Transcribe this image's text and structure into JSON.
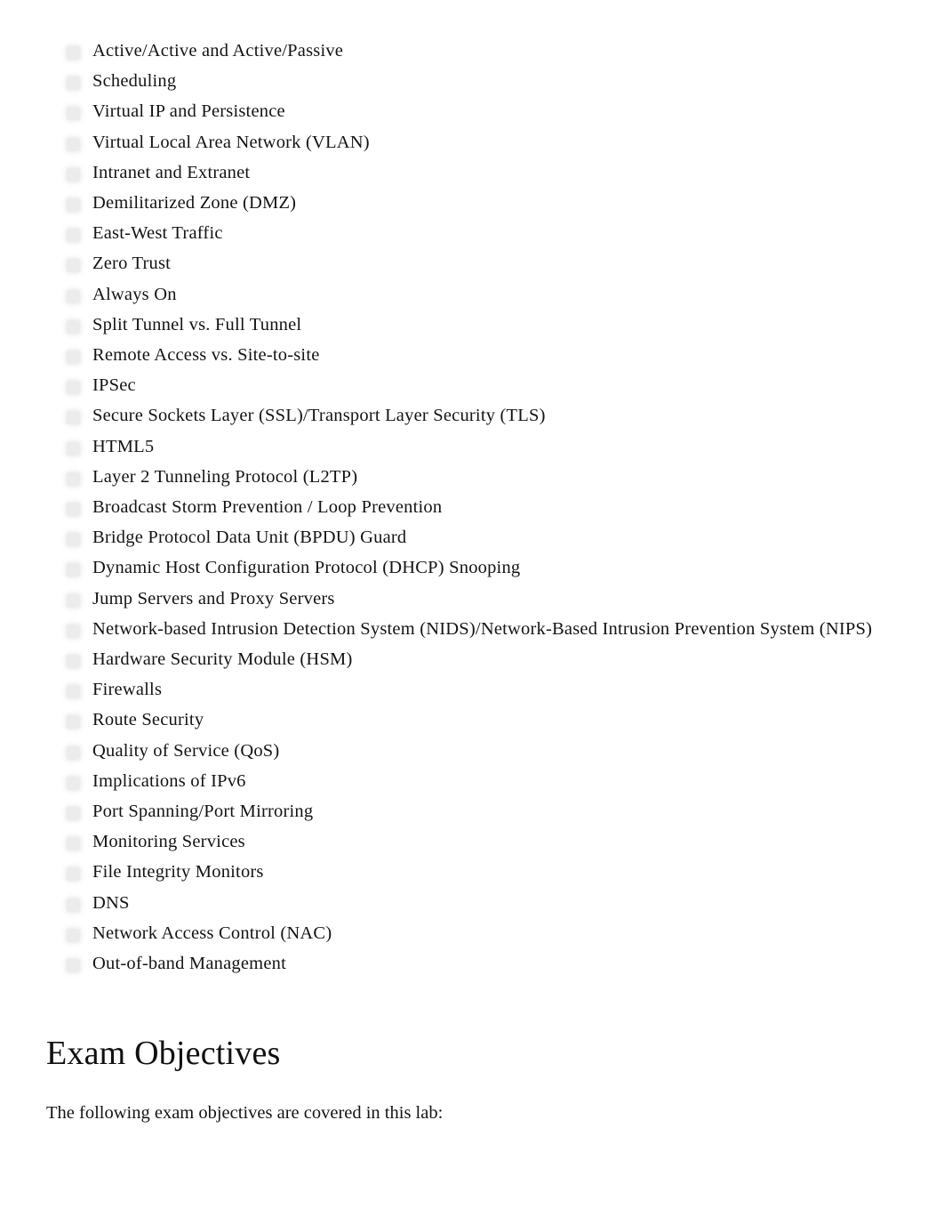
{
  "document": {
    "background_color": "#ffffff",
    "text_color": "#141414",
    "bullet_color": "#ececec"
  },
  "topic_list": {
    "bullet_icon": "square-bullet-icon",
    "items": [
      "Active/Active and Active/Passive",
      "Scheduling",
      "Virtual IP and Persistence",
      "Virtual Local Area Network (VLAN)",
      "Intranet and Extranet",
      "Demilitarized Zone (DMZ)",
      "East-West Traffic",
      "Zero Trust",
      "Always On",
      "Split Tunnel vs. Full Tunnel",
      "Remote Access vs. Site-to-site",
      "IPSec",
      "Secure Sockets Layer (SSL)/Transport Layer Security (TLS)",
      "HTML5",
      "Layer 2 Tunneling Protocol (L2TP)",
      "Broadcast Storm Prevention / Loop Prevention",
      "Bridge Protocol Data Unit (BPDU) Guard",
      "Dynamic Host Configuration Protocol (DHCP) Snooping",
      "Jump Servers and Proxy Servers",
      "Network-based Intrusion Detection System (NIDS)/Network-Based Intrusion Prevention System (NIPS)",
      "Hardware Security Module (HSM)",
      "Firewalls",
      "Route Security",
      "Quality of Service (QoS)",
      "Implications of IPv6",
      "Port Spanning/Port Mirroring",
      "Monitoring Services",
      "File Integrity Monitors",
      "DNS",
      "Network Access Control (NAC)",
      "Out-of-band Management"
    ]
  },
  "exam_objectives": {
    "heading": "Exam Objectives",
    "intro": "The following exam objectives are covered in this lab:"
  }
}
